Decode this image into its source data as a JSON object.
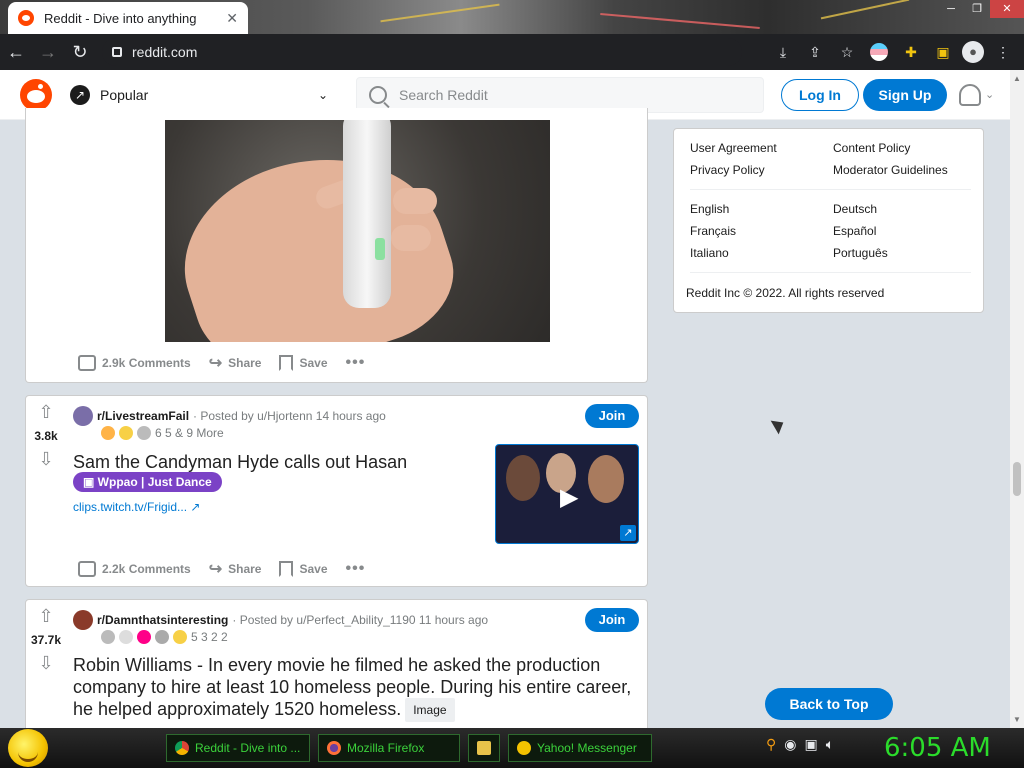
{
  "browser": {
    "tab_title": "Reddit - Dive into anything",
    "url": "reddit.com"
  },
  "header": {
    "feed_label": "Popular",
    "search_placeholder": "Search Reddit",
    "login_label": "Log In",
    "signup_label": "Sign Up"
  },
  "posts": [
    {
      "comments": "2.9k Comments",
      "share": "Share",
      "save": "Save"
    },
    {
      "votes": "3.8k",
      "subreddit": "r/LivestreamFail",
      "posted_by": "· Posted by u/Hjortenn 14 hours ago",
      "awards": "6    5 & 9 More",
      "join": "Join",
      "title": "Sam the Candyman Hyde calls out Hasan",
      "flair": "Wppao | Just Dance",
      "link": "clips.twitch.tv/Frigid...",
      "comments": "2.2k Comments",
      "share": "Share",
      "save": "Save"
    },
    {
      "votes": "37.7k",
      "subreddit": "r/Damnthatsinteresting",
      "posted_by": "· Posted by u/Perfect_Ability_1190 11 hours ago",
      "awards": "5   3   2   2",
      "join": "Join",
      "title": "Robin Williams - In every movie he filmed he asked the production company to hire at least 10 homeless people. During his entire career, he helped approximately 1520 homeless.",
      "tag": "Image"
    }
  ],
  "sidebar": {
    "links_left": [
      "User Agreement",
      "Privacy Policy"
    ],
    "links_right": [
      "Content Policy",
      "Moderator Guidelines"
    ],
    "langs_left": [
      "English",
      "Français",
      "Italiano"
    ],
    "langs_right": [
      "Deutsch",
      "Español",
      "Português"
    ],
    "copyright": "Reddit Inc © 2022. All rights reserved",
    "back_to_top": "Back to Top"
  },
  "taskbar": {
    "tasks": [
      "Reddit - Dive into ...",
      "Mozilla Firefox",
      "Yahoo! Messenger"
    ],
    "clock": "6:05 AM"
  }
}
